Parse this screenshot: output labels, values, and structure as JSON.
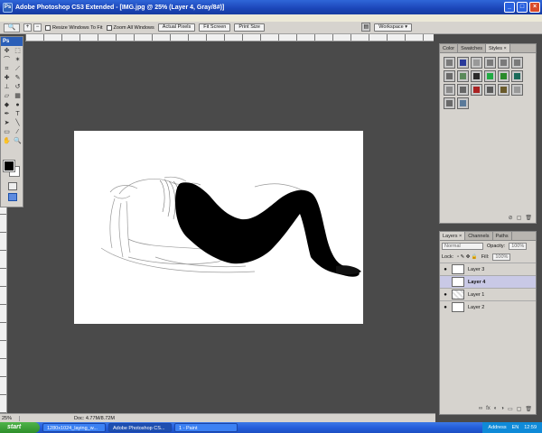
{
  "window": {
    "title": "Adobe Photoshop CS3 Extended - [IMG.jpg @ 25% (Layer 4, Gray/8#)]",
    "app_badge": "Ps"
  },
  "options_bar": {
    "resize_windows_label": "Resize Windows To Fit",
    "zoom_all_windows_label": "Zoom All Windows",
    "actual_pixels_label": "Actual Pixels",
    "fit_screen_label": "Fit Screen",
    "print_size_label": "Print Size",
    "workspace_label": "Workspace ▾"
  },
  "status_bar": {
    "zoom": "25%",
    "doc_info": "Doc: 4.77M/8.72M"
  },
  "styles_panel": {
    "tabs": [
      "Color",
      "Swatches",
      "Styles ×"
    ],
    "active_tab": "Styles ×",
    "styles": [
      "#7a7a7a",
      "#2a3a9a",
      "#999999",
      "#7a7a7a",
      "#7a7a7a",
      "#7a7a7a",
      "#6a6a6a",
      "#5a8a5a",
      "#2a2a2a",
      "#22aa44",
      "#2a8a2a",
      "#1a6a5a",
      "#8a8a8a",
      "#666666",
      "#aa2222",
      "#5a5a5a",
      "#6a5a2a",
      "#999999",
      "#6a6a6a",
      "#5a7a9a"
    ]
  },
  "layers_panel": {
    "tabs": [
      "Layers ×",
      "Channels",
      "Paths"
    ],
    "blend_mode": "Normal",
    "opacity_label": "Opacity:",
    "opacity_value": "100%",
    "lock_label": "Lock:",
    "fill_label": "Fill:",
    "fill_value": "100%",
    "layers": [
      {
        "name": "Layer 3",
        "visible": true,
        "selected": false
      },
      {
        "name": "Layer 4",
        "visible": false,
        "selected": true
      },
      {
        "name": "Layer 1",
        "visible": true,
        "selected": false
      },
      {
        "name": "Layer 2",
        "visible": true,
        "selected": false
      }
    ]
  },
  "taskbar": {
    "start_label": "start",
    "items": [
      "1280x1024_laying_w...",
      "Adobe Photoshop CS...",
      "1 - Paint"
    ],
    "active_index": 1,
    "address_label": "Address",
    "lang": "EN",
    "clock": "12:59"
  }
}
